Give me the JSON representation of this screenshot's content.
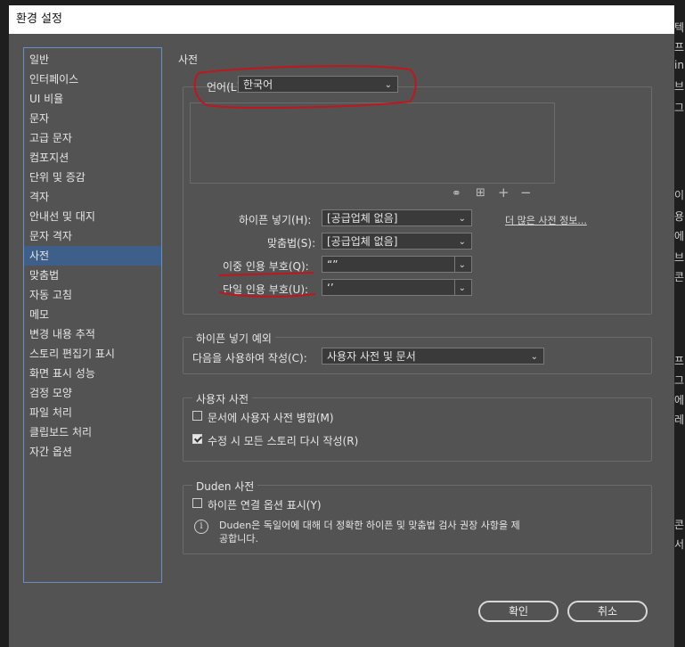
{
  "window": {
    "title": "환경 설정"
  },
  "sidebar": {
    "items": [
      {
        "label": "일반"
      },
      {
        "label": "인터페이스"
      },
      {
        "label": "UI 비율"
      },
      {
        "label": "문자"
      },
      {
        "label": "고급 문자"
      },
      {
        "label": "컴포지션"
      },
      {
        "label": "단위 및 증감"
      },
      {
        "label": "격자"
      },
      {
        "label": "안내선 및 대지"
      },
      {
        "label": "문자 격자"
      },
      {
        "label": "사전"
      },
      {
        "label": "맞춤법"
      },
      {
        "label": "자동 고침"
      },
      {
        "label": "메모"
      },
      {
        "label": "변경 내용 추적"
      },
      {
        "label": "스토리 편집기 표시"
      },
      {
        "label": "화면 표시 성능"
      },
      {
        "label": "검정 모양"
      },
      {
        "label": "파일 처리"
      },
      {
        "label": "클립보드 처리"
      },
      {
        "label": "자간 옵션"
      }
    ],
    "selected": "사전"
  },
  "main": {
    "section_title": "사전",
    "language": {
      "label": "언어(L):",
      "value": "한국어"
    },
    "hyphenation": {
      "label": "하이픈 넣기(H):",
      "value": "[공급업체 없음]"
    },
    "spelling": {
      "label": "맞춤법(S):",
      "value": "[공급업체 없음]"
    },
    "double_quotes": {
      "label": "이중 인용 부호(Q):",
      "value": "“”"
    },
    "single_quotes": {
      "label": "단일 인용 부호(U):",
      "value": "‘’"
    },
    "more_info_link": "더 많은 사전 정보..."
  },
  "hyphen_exceptions": {
    "group_label": "하이픈 넣기 예외",
    "compose_label": "다음을 사용하여 작성(C):",
    "compose_value": "사용자 사전 및 문서"
  },
  "user_dictionary": {
    "group_label": "사용자 사전",
    "merge_label": "문서에 사용자 사전 병합(M)",
    "merge_checked": false,
    "recompose_label": "수정 시 모든 스토리 다시 작성(R)",
    "recompose_checked": true
  },
  "duden": {
    "group_label": "Duden 사전",
    "show_options_label": "하이픈 연결 옵션 표시(Y)",
    "show_options_checked": false,
    "info_line1": "Duden은 독일어에 대해 더 정확한 하이픈 및 맞춤법 검사 권장 사항을 제",
    "info_line2": "공합니다."
  },
  "buttons": {
    "ok": "확인",
    "cancel": "취소"
  },
  "background_strip": [
    "텍",
    "프",
    "ini",
    "브",
    "그",
    "이",
    "용",
    "에",
    "브",
    "콘",
    "프",
    "그",
    "에",
    "레",
    "콘",
    "서"
  ]
}
